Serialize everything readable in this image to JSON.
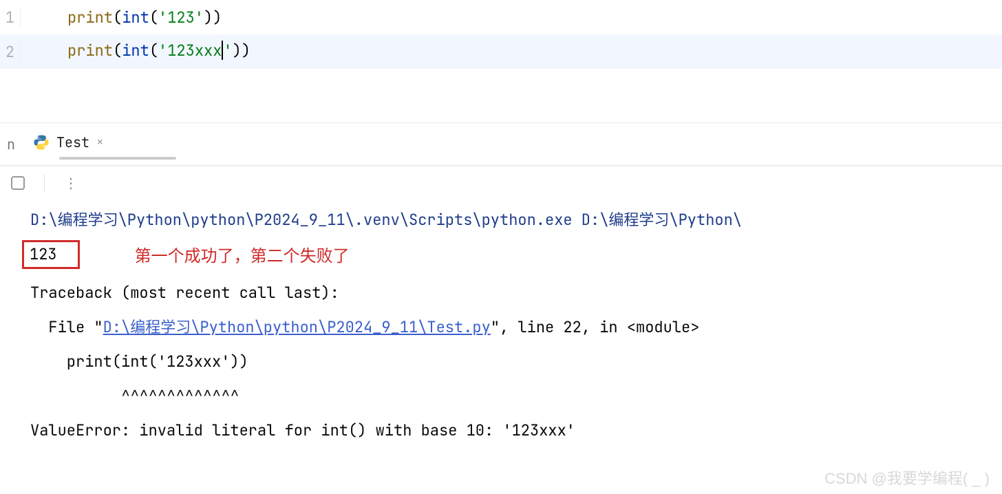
{
  "editor": {
    "lines": [
      {
        "n": "1",
        "print": "print",
        "int": "int",
        "open": "(",
        "open2": "(",
        "str": "'123'",
        "close2": ")",
        "close": ")"
      },
      {
        "n": "2",
        "print": "print",
        "int": "int",
        "open": "(",
        "open2": "(",
        "str_a": "'123xxx",
        "str_b": "'",
        "close2": ")",
        "close": ")"
      }
    ]
  },
  "tab": {
    "run_label": "n",
    "name": "Test",
    "close": "×"
  },
  "toolbar": {
    "kebab": "⋮"
  },
  "console": {
    "cmd_pre": "D:\\编程学习\\Python\\python\\P2024_9_11\\.venv\\Scripts\\python.exe D:\\编程学习\\Python\\",
    "result": "123",
    "annotation": "第一个成功了，第二个失败了",
    "traceback": "Traceback (most recent call last):",
    "file_pre": "  File \"",
    "file_link": "D:\\编程学习\\Python\\python\\P2024_9_11\\Test.py",
    "file_post": "\", line 22, in <module>",
    "src": "    print(int('123xxx'))",
    "carets": "          ^^^^^^^^^^^^^",
    "blank": "",
    "error": "ValueError: invalid literal for int() with base 10: '123xxx'"
  },
  "watermark": "CSDN @我要学编程( _ )"
}
